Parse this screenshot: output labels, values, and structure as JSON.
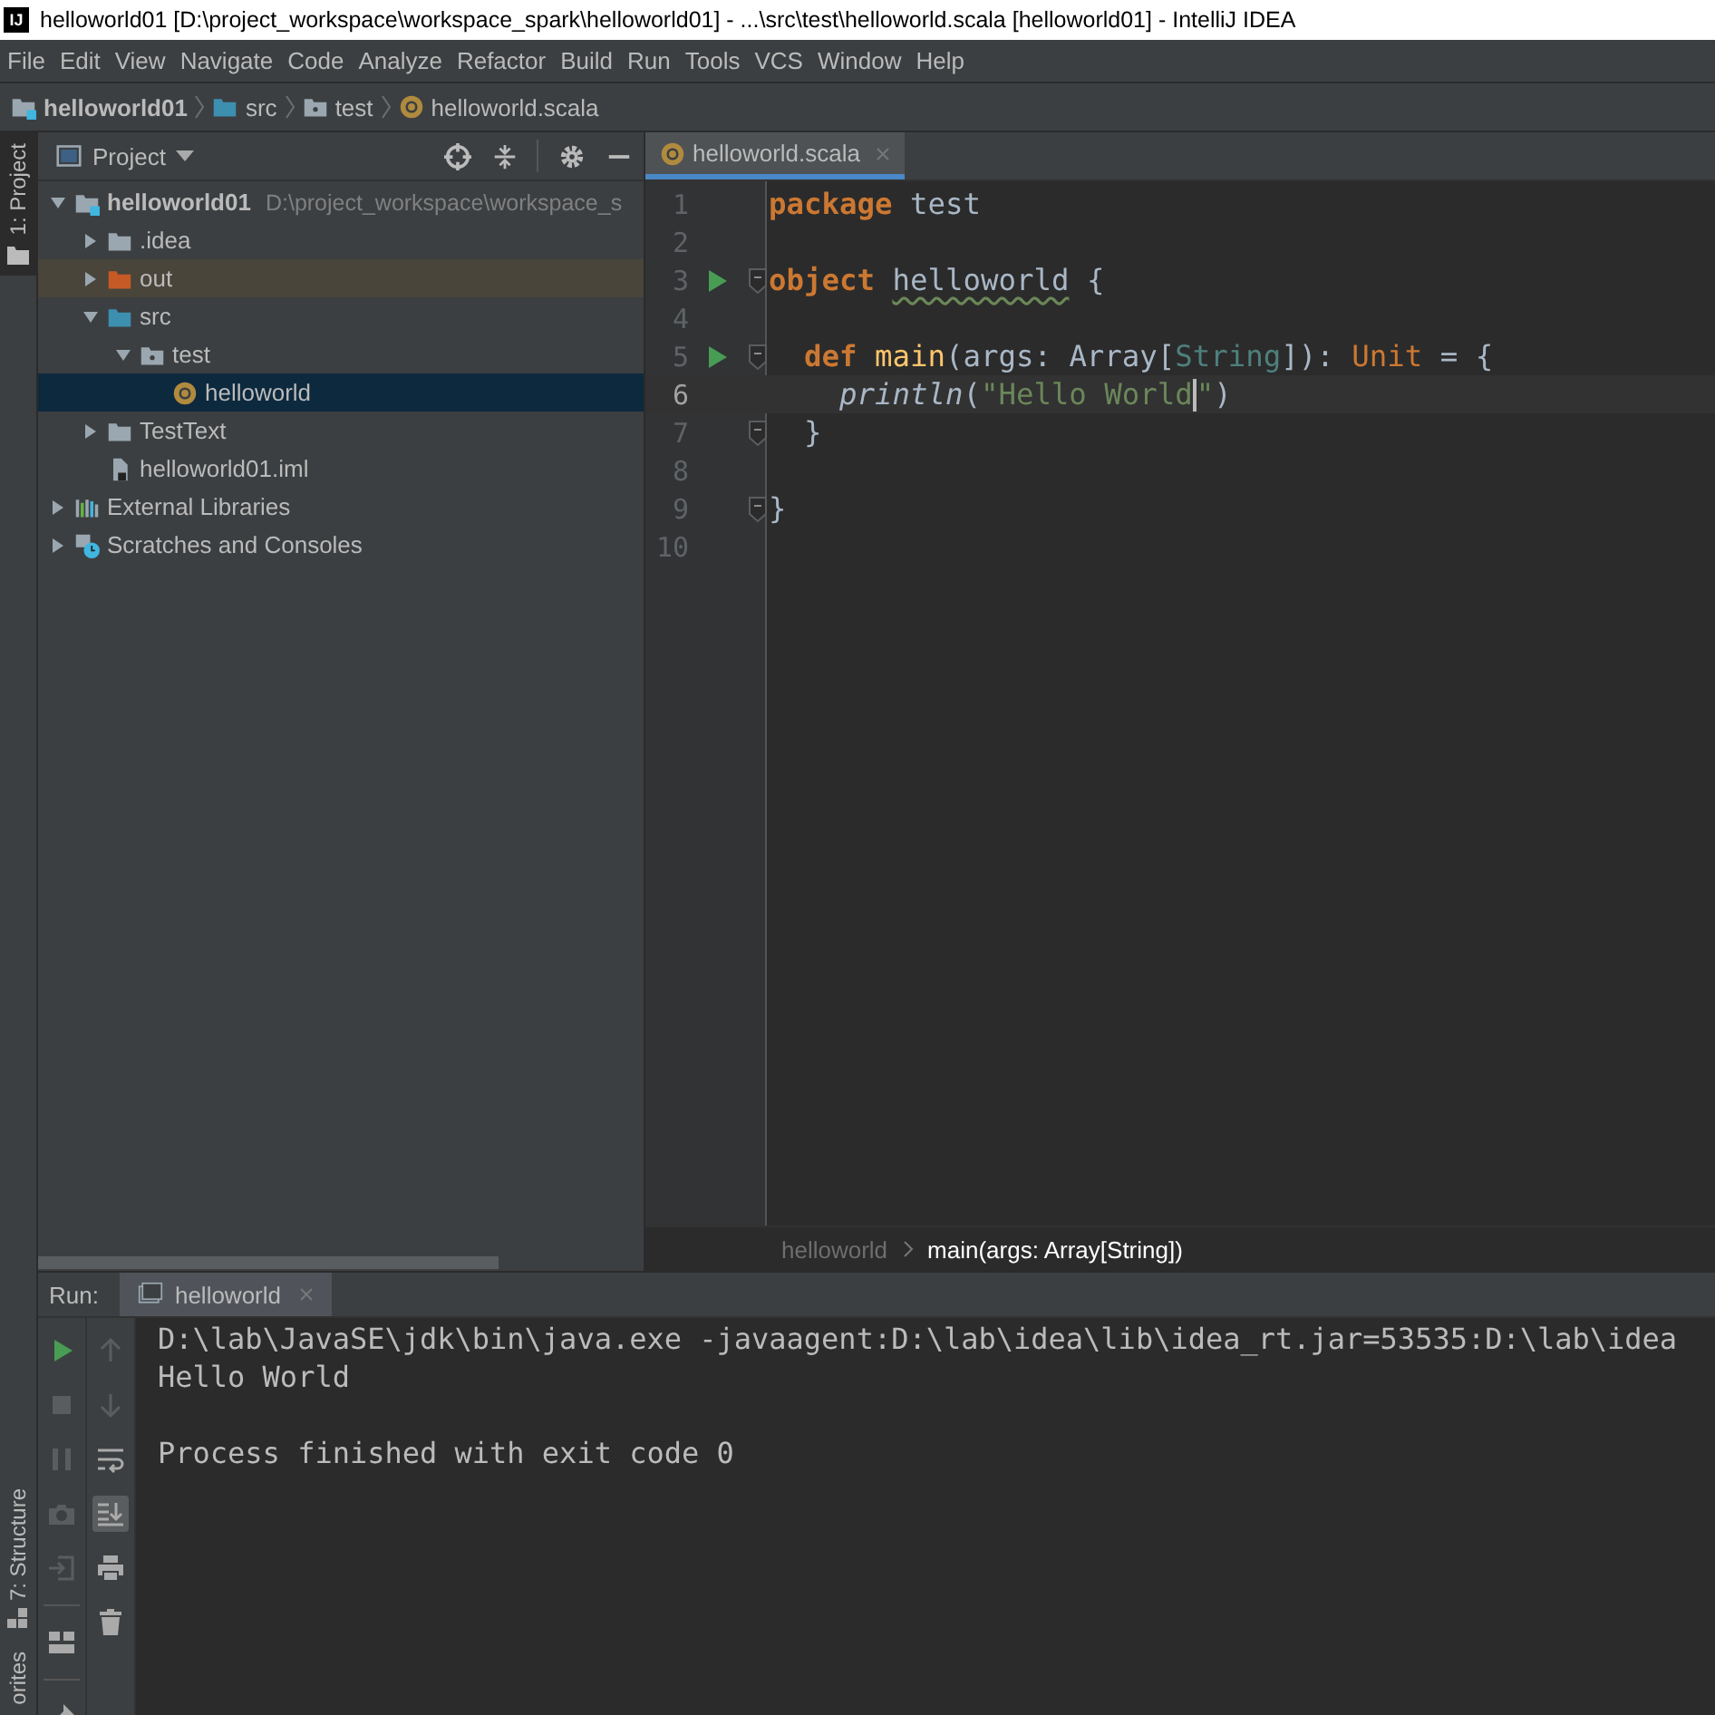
{
  "window": {
    "logo_text": "IJ",
    "title": "helloworld01 [D:\\project_workspace\\workspace_spark\\helloworld01] - ...\\src\\test\\helloworld.scala [helloworld01] - IntelliJ IDEA"
  },
  "menu": [
    "File",
    "Edit",
    "View",
    "Navigate",
    "Code",
    "Analyze",
    "Refactor",
    "Build",
    "Run",
    "Tools",
    "VCS",
    "Window",
    "Help"
  ],
  "navbar": [
    {
      "label": "helloworld01",
      "kind": "module"
    },
    {
      "label": "src",
      "kind": "source"
    },
    {
      "label": "test",
      "kind": "package"
    },
    {
      "label": "helloworld.scala",
      "kind": "scala"
    }
  ],
  "left_stripe": [
    {
      "label": "1: Project",
      "selected": true,
      "kind": "project"
    },
    {
      "label": "7: Structure",
      "selected": false,
      "kind": "structure"
    },
    {
      "label": "orites",
      "selected": false,
      "kind": "favorites"
    }
  ],
  "project": {
    "title": "Project",
    "tree": [
      {
        "label": "helloworld01",
        "path": "D:\\project_workspace\\workspace_s",
        "kind": "module",
        "expanded": true,
        "selected": false,
        "children": [
          {
            "label": ".idea",
            "kind": "folder",
            "expanded": false,
            "selected": false
          },
          {
            "label": "out",
            "kind": "excluded",
            "expanded": false,
            "selected": false
          },
          {
            "label": "src",
            "kind": "source",
            "expanded": true,
            "selected": false,
            "children": [
              {
                "label": "test",
                "kind": "package",
                "expanded": true,
                "selected": false,
                "children": [
                  {
                    "label": "helloworld",
                    "kind": "scala",
                    "selected": true
                  }
                ]
              }
            ]
          },
          {
            "label": "TestText",
            "kind": "folder",
            "expanded": false,
            "selected": false
          },
          {
            "label": "helloworld01.iml",
            "kind": "iml",
            "selected": false
          }
        ]
      },
      {
        "label": "External Libraries",
        "kind": "libraries",
        "expanded": false,
        "selected": false
      },
      {
        "label": "Scratches and Consoles",
        "kind": "scratches",
        "expanded": false,
        "selected": false
      }
    ]
  },
  "editor": {
    "tab": {
      "label": "helloworld.scala",
      "selected": true
    },
    "lines": [
      {
        "number": "1",
        "run": false,
        "fold": false,
        "current": false,
        "tokens": [
          {
            "text": "package",
            "kind": "keyword"
          },
          {
            "text": " test",
            "kind": "plain"
          }
        ]
      },
      {
        "number": "2",
        "run": false,
        "fold": false,
        "current": false
      },
      {
        "number": "3",
        "run": true,
        "fold": true,
        "current": false,
        "tokens": [
          {
            "text": "object ",
            "kind": "keyword"
          },
          {
            "text": "helloworld",
            "kind": "warning"
          },
          {
            "text": " {",
            "kind": "plain"
          }
        ]
      },
      {
        "number": "4",
        "run": false,
        "fold": false,
        "current": false
      },
      {
        "number": "5",
        "run": true,
        "fold": true,
        "current": false,
        "tokens": [
          {
            "text": "  def ",
            "kind": "keyword"
          },
          {
            "text": "main",
            "kind": "method"
          },
          {
            "text": "(args: Array[",
            "kind": "plain"
          },
          {
            "text": "String",
            "kind": "typeparam"
          },
          {
            "text": "]): ",
            "kind": "plain"
          },
          {
            "text": "Unit",
            "kind": "type"
          },
          {
            "text": " = {",
            "kind": "plain"
          }
        ]
      },
      {
        "number": "6",
        "run": false,
        "fold": false,
        "current": true,
        "tokens": [
          {
            "text": "    println",
            "kind": "call"
          },
          {
            "text": "(",
            "kind": "plain"
          },
          {
            "text": "\"Hello World",
            "kind": "string",
            "caret_after": true
          },
          {
            "text": "\"",
            "kind": "string"
          },
          {
            "text": ")",
            "kind": "plain"
          }
        ]
      },
      {
        "number": "7",
        "run": false,
        "fold": true,
        "current": false,
        "tokens": [
          {
            "text": "  }",
            "kind": "plain"
          }
        ]
      },
      {
        "number": "8",
        "run": false,
        "fold": false,
        "current": false
      },
      {
        "number": "9",
        "run": false,
        "fold": true,
        "current": false,
        "tokens": [
          {
            "text": "}",
            "kind": "plain"
          }
        ]
      },
      {
        "number": "10",
        "run": false,
        "fold": false,
        "current": false
      }
    ],
    "breadcrumbs": [
      "helloworld",
      "main(args: Array[String])"
    ]
  },
  "run": {
    "label": "Run:",
    "tab": {
      "label": "helloworld",
      "selected": true
    },
    "scroll_to_end": true,
    "console": [
      {
        "text": "D:\\lab\\JavaSE\\jdk\\bin\\java.exe -javaagent:D:\\lab\\idea\\lib\\idea_rt.jar=53535:D:\\lab\\idea",
        "kind": "command"
      },
      {
        "text": "Hello World",
        "kind": "output"
      },
      {
        "text": "Process finished with exit code 0",
        "kind": "exit"
      }
    ]
  }
}
